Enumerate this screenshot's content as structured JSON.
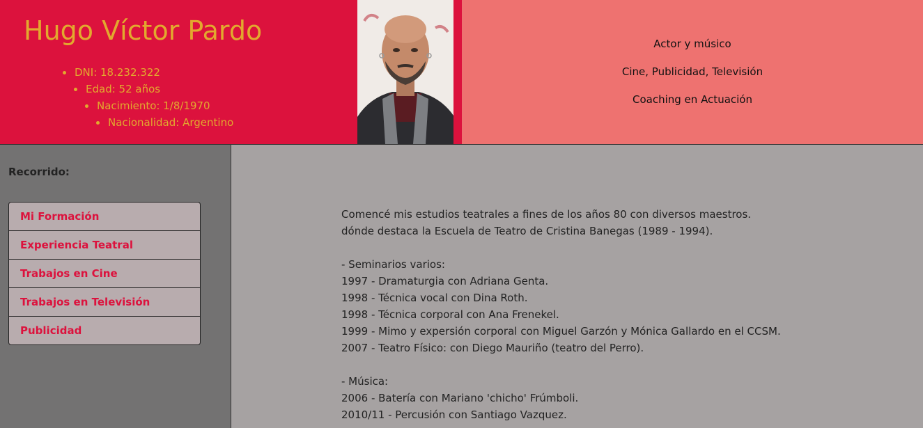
{
  "header": {
    "name": "Hugo Víctor Pardo",
    "facts": [
      "DNI: 18.232.322",
      "Edad: 52 años",
      "Nacimiento: 1/8/1970",
      "Nacionalidad: Argentino"
    ],
    "taglines": [
      "Actor y músico",
      "Cine, Publicidad, Televisión",
      "Coaching en Actuación"
    ]
  },
  "sidebar": {
    "heading": "Recorrido:",
    "items": [
      "Mi Formación",
      "Experiencia Teatral",
      "Trabajos en Cine",
      "Trabajos en Televisión",
      "Publicidad"
    ]
  },
  "content": {
    "intro": [
      "Comencé mis estudios teatrales a fines de los años 80 con diversos maestros.",
      "dónde destaca la Escuela de Teatro de Cristina Banegas (1989 - 1994)."
    ],
    "seminarios": [
      "- Seminarios varios:",
      "1997 - Dramaturgia con Adriana Genta.",
      "1998 - Técnica vocal con Dina Roth.",
      "1998 - Técnica corporal con Ana Frenekel.",
      "1999 - Mimo y expersión corporal con Miguel Garzón y Mónica Gallardo en el CCSM.",
      "2007 - Teatro Físico: con Diego Mauriño (teatro del Perro)."
    ],
    "musica": [
      "- Música:",
      "2006 - Batería con Mariano 'chicho' Frúmboli.",
      "2010/11 - Percusión con Santiago Vazquez."
    ]
  },
  "colors": {
    "header_red": "#dc123d",
    "header_salmon": "#ee7270",
    "name_gold": "#e2a92e",
    "sidebar_gray": "#737272",
    "content_gray": "#a6a2a2",
    "menu_bg": "#b8acae"
  }
}
